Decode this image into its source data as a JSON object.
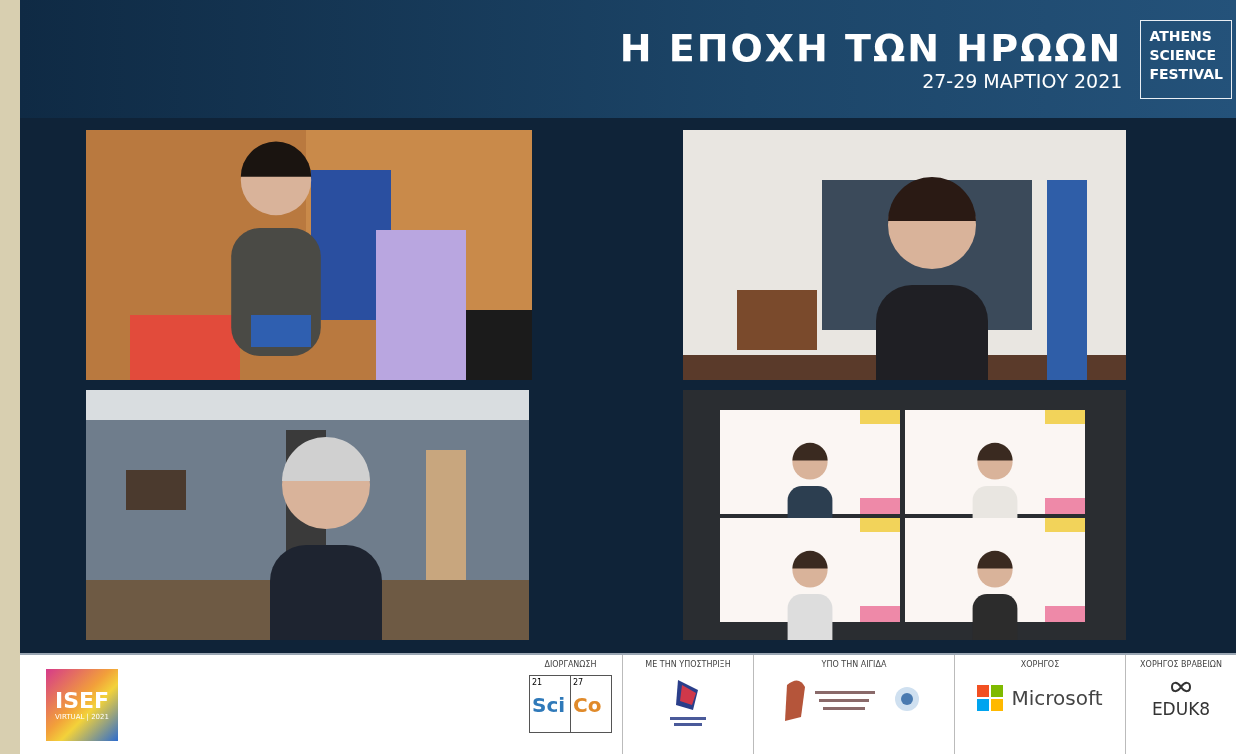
{
  "header": {
    "title": "Η ΕΠΟΧΗ ΤΩΝ ΗΡΩΩΝ",
    "date": "27-29 ΜΑΡΤΙΟΥ 2021",
    "festival_logo": [
      "ATHENS",
      "SCIENCE",
      "FESTIVAL"
    ]
  },
  "footer": {
    "event_logo": {
      "title": "ISEF",
      "subtitle": "VIRTUAL | 2021"
    },
    "sponsors": [
      {
        "label": "ΔΙΟΡΓΑΝΩΣΗ",
        "kind": "scico",
        "cells": [
          {
            "number": "21",
            "symbol": "Sci"
          },
          {
            "number": "27",
            "symbol": "Co"
          }
        ]
      },
      {
        "label": "ΜΕ ΤΗΝ ΥΠΟΣΤΗΡΙΞΗ",
        "kind": "emblem"
      },
      {
        "label": "ΥΠΟ ΤΗΝ ΑΙΓΙΔΑ",
        "kind": "ministry"
      },
      {
        "label": "ΧΟΡΗΓΟΣ",
        "kind": "microsoft",
        "name": "Microsoft"
      },
      {
        "label": "ΧΟΡΗΓΟΣ ΒΡΑΒΕΙΩΝ",
        "kind": "eduk8",
        "name": "EDUK8"
      }
    ]
  }
}
